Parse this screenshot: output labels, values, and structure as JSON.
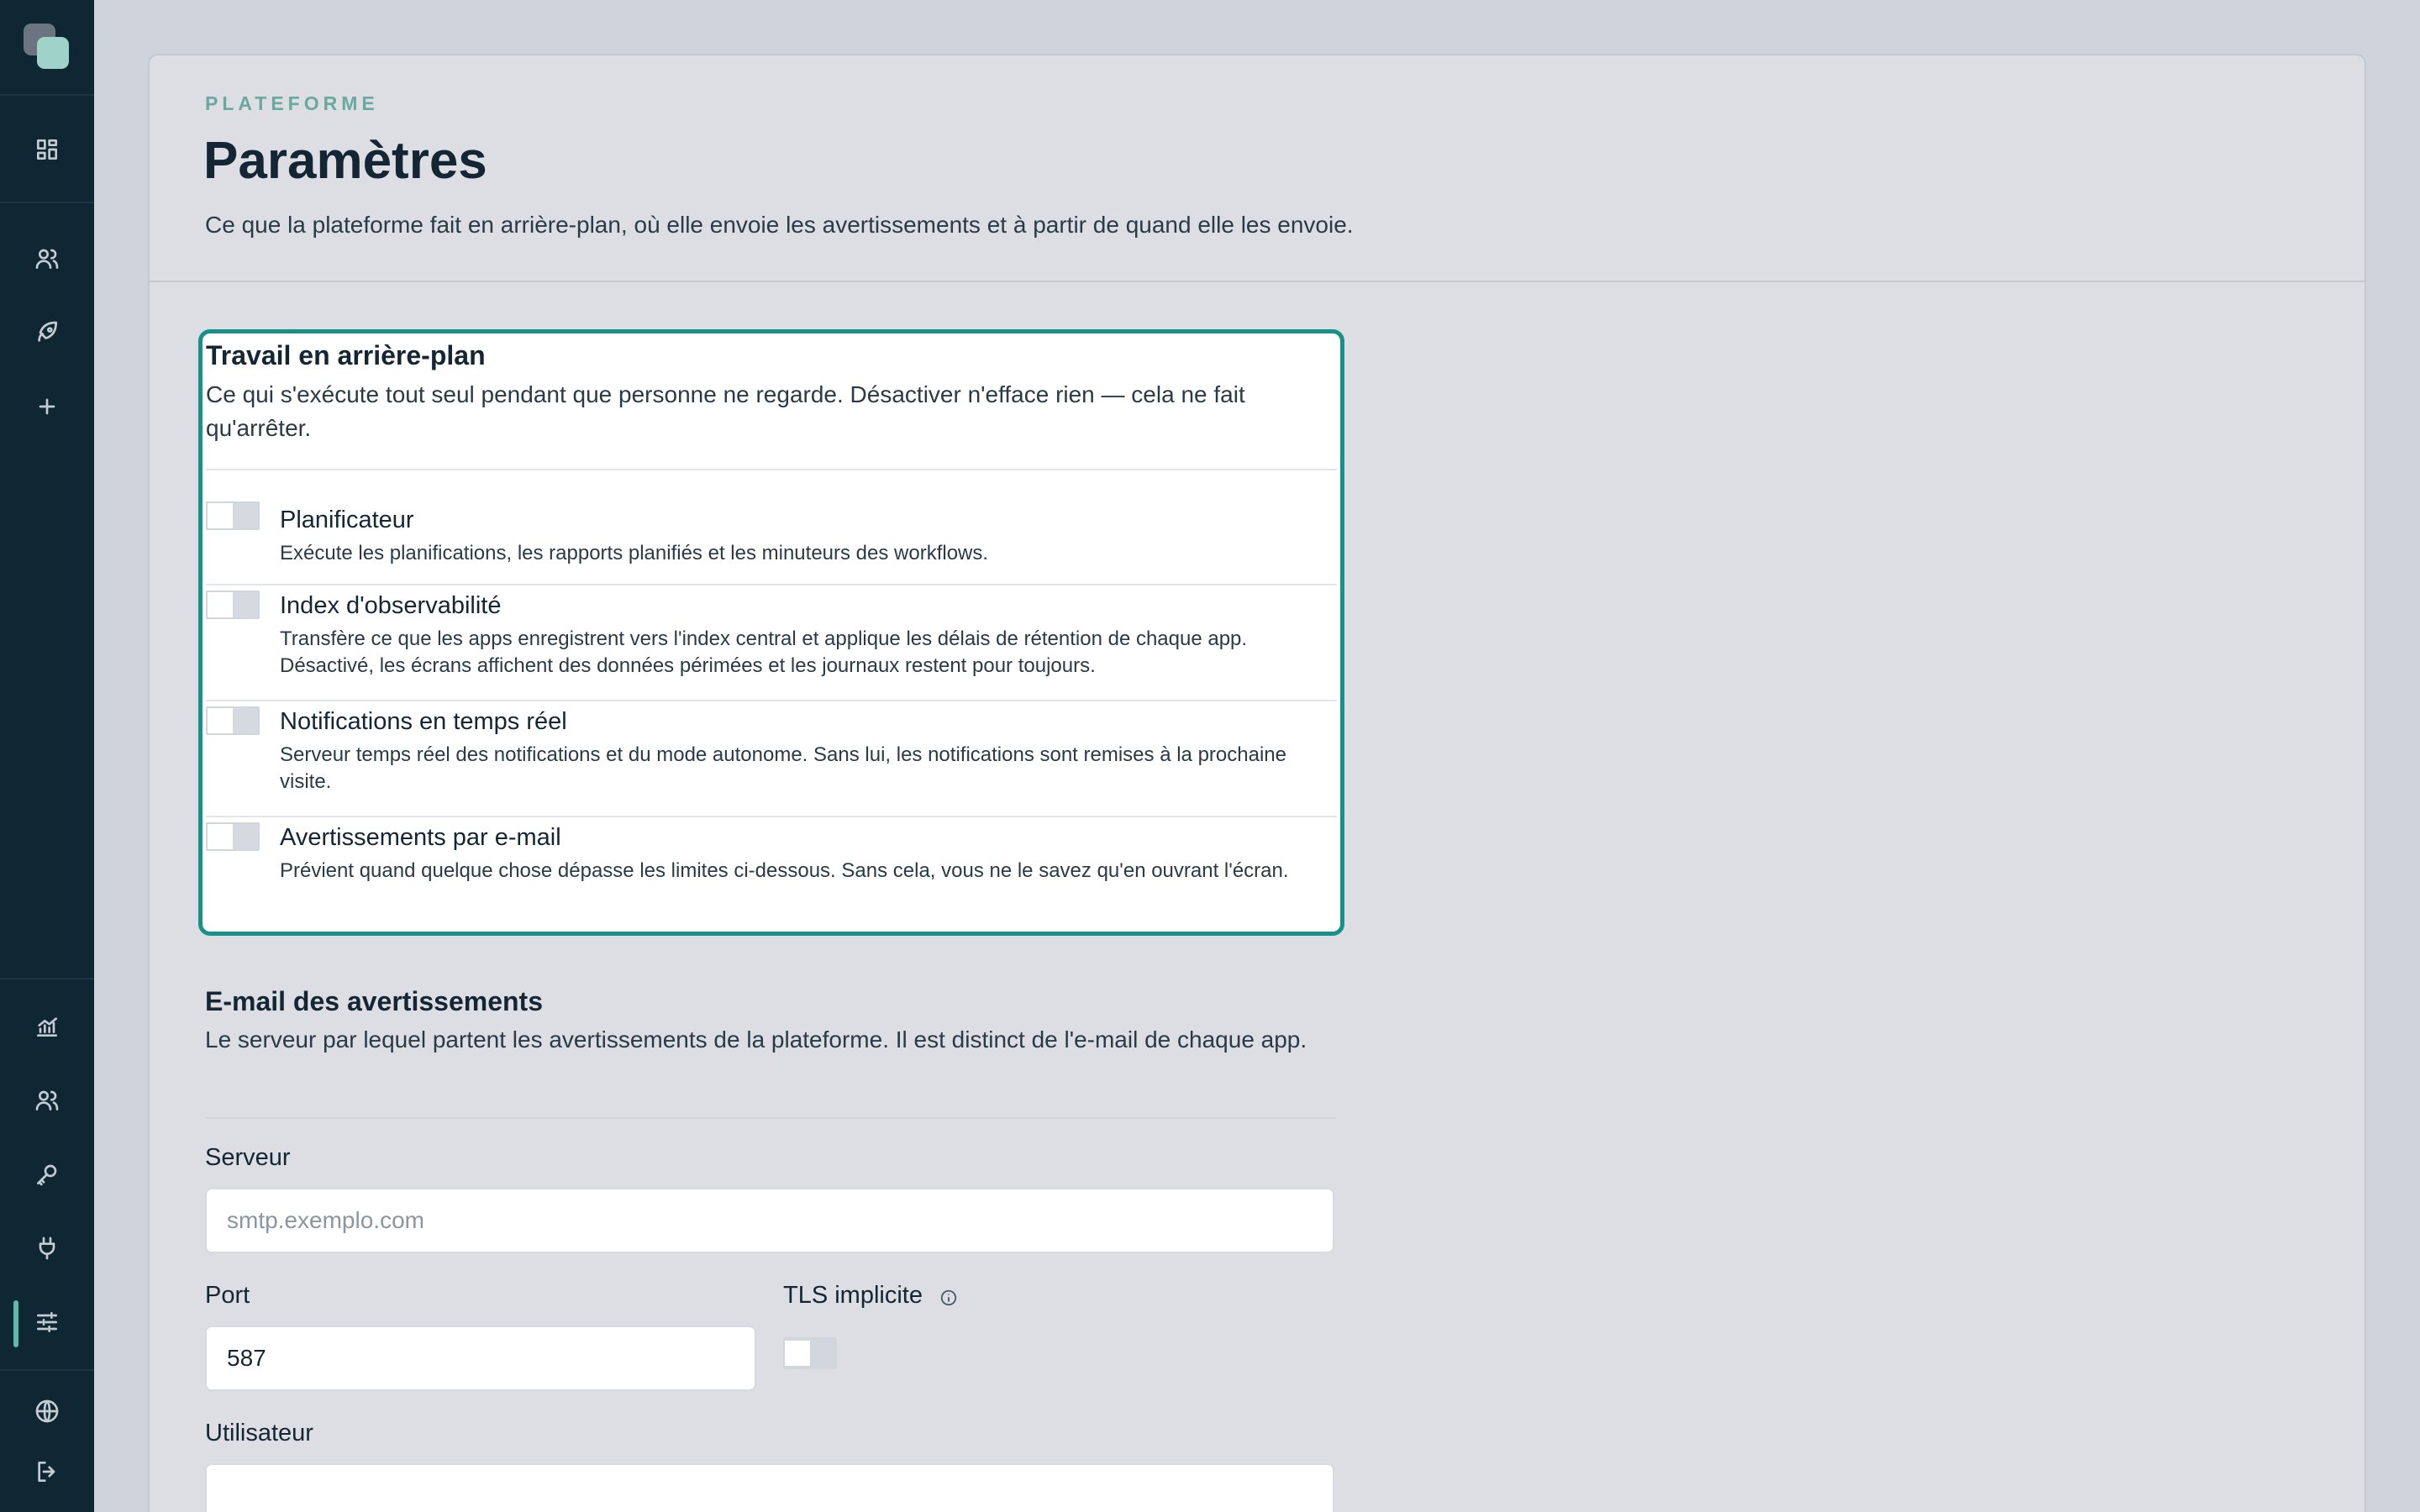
{
  "sidebar": {
    "icons": [
      "dashboard-icon",
      "users-icon",
      "rocket-icon",
      "plus-icon",
      "analytics-icon",
      "team-icon",
      "key-icon",
      "plug-icon",
      "settings-sliders-icon",
      "globe-icon",
      "logout-icon"
    ],
    "active": "settings-sliders-icon"
  },
  "header": {
    "eyebrow": "PLATEFORME",
    "title": "Paramètres",
    "description": "Ce que la plateforme fait en arrière-plan, où elle envoie les avertissements et à partir de quand elle les envoie."
  },
  "background_section": {
    "title": "Travail en arrière-plan",
    "description": "Ce qui s'exécute tout seul pendant que personne ne regarde. Désactiver n'efface rien — cela ne fait qu'arrêter.",
    "items": [
      {
        "title": "Planificateur",
        "description": "Exécute les planifications, les rapports planifiés et les minuteurs des workflows.",
        "enabled": false
      },
      {
        "title": "Index d'observabilité",
        "description": "Transfère ce que les apps enregistrent vers l'index central et applique les délais de rétention de chaque app. Désactivé, les écrans affichent des données périmées et les journaux restent pour toujours.",
        "enabled": false
      },
      {
        "title": "Notifications en temps réel",
        "description": "Serveur temps réel des notifications et du mode autonome. Sans lui, les notifications sont remises à la prochaine visite.",
        "enabled": false
      },
      {
        "title": "Avertissements par e-mail",
        "description": "Prévient quand quelque chose dépasse les limites ci-dessous. Sans cela, vous ne le savez qu'en ouvrant l'écran.",
        "enabled": false
      }
    ]
  },
  "email_section": {
    "title": "E-mail des avertissements",
    "description": "Le serveur par lequel partent les avertissements de la plateforme. Il est distinct de l'e-mail de chaque app.",
    "server_label": "Serveur",
    "server_placeholder": "smtp.exemplo.com",
    "server_value": "",
    "port_label": "Port",
    "port_value": "587",
    "tls_label": "TLS implicite",
    "tls_enabled": false,
    "user_label": "Utilisateur",
    "user_value": ""
  },
  "colors": {
    "sidebar_bg": "#0f2633",
    "accent": "#17918a",
    "eyebrow": "#6aa8a0"
  }
}
